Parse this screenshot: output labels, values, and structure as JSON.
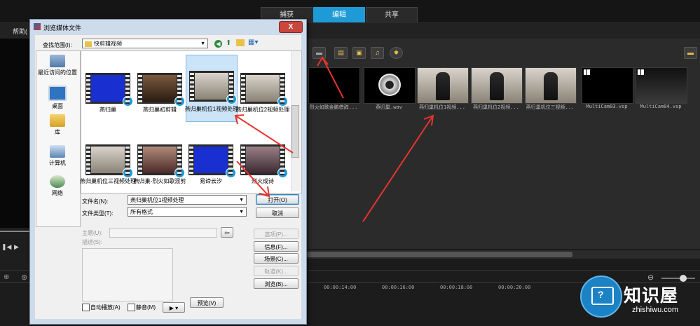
{
  "app": {
    "tabs": [
      "捕获",
      "编辑",
      "共享"
    ],
    "active_tab": "编辑",
    "menu_help": "帮助(",
    "timecodes": [
      "00:00:14:00",
      "00:00:16:00",
      "00:00:18:00",
      "00:00:20:00"
    ],
    "library_items": [
      {
        "label": "烈火如歌金鹏借辞..."
      },
      {
        "label": "燕归巢.wav"
      },
      {
        "label": "燕归巢机位1视频..."
      },
      {
        "label": "燕归巢机位2视频..."
      },
      {
        "label": "燕归巢机位三视频..."
      },
      {
        "label": "MultiCam03.vsp"
      },
      {
        "label": "MultiCam04.vsp"
      }
    ]
  },
  "dialog": {
    "title": "浏览媒体文件",
    "close_glyph": "X",
    "look_in_label": "查找范围(I):",
    "look_in_value": "快剪辑视频",
    "places": [
      "最近访问的位置",
      "桌面",
      "库",
      "计算机",
      "网络"
    ],
    "files": [
      {
        "name": "燕归巢"
      },
      {
        "name": "燕归巢初剪辑"
      },
      {
        "name": "燕归巢机位1视频处理"
      },
      {
        "name": "燕归巢机位2视频处理"
      },
      {
        "name": "燕归巢机位三视频处理"
      },
      {
        "name": "燕归巢-烈火如歌混剪"
      },
      {
        "name": "易谛云汐"
      },
      {
        "name": "烈火成诗"
      }
    ],
    "selected_file": "燕归巢机位1视频处理",
    "filename_label": "文件名(N):",
    "filename_value": "燕归巢机位1视频处理",
    "filetype_label": "文件类型(T):",
    "filetype_value": "所有格式",
    "open_button": "打开(O)",
    "cancel_button": "取消",
    "subject_label": "主题(U):",
    "description_label": "描述(S):",
    "side_buttons": [
      "选项(P)...",
      "信息(F)...",
      "场景(C)...",
      "轨道(K)...",
      "浏览(B)..."
    ],
    "autoplay_label": "自动播放(A)",
    "mute_label": "静音(M)",
    "preview_button": "预览(V)",
    "play_glyph": "▶ ▾",
    "back_glyph": "⇦"
  },
  "watermark": {
    "title": "知识屋",
    "subtitle": "zhishiwu.com"
  },
  "colors": {
    "accent": "#1e9ad6",
    "arrow": "#e8332e"
  }
}
